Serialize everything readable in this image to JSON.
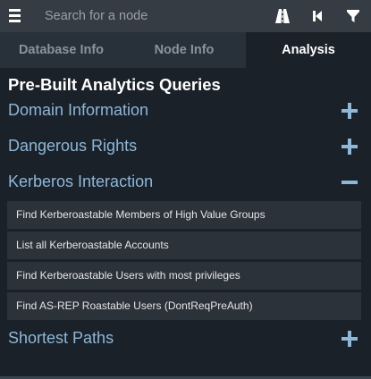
{
  "search": {
    "placeholder": "Search for a node"
  },
  "toolbar": {
    "menu_icon": "hamburger-menu-icon",
    "pathfinding_icon": "road-icon",
    "back_icon": "step-backward-icon",
    "filter_icon": "filter-icon"
  },
  "tabs": [
    {
      "label": "Database Info",
      "active": false
    },
    {
      "label": "Node Info",
      "active": false
    },
    {
      "label": "Analysis",
      "active": true
    }
  ],
  "analysis": {
    "title": "Pre-Built Analytics Queries",
    "groups": [
      {
        "label": "Domain Information",
        "expanded": false
      },
      {
        "label": "Dangerous Rights",
        "expanded": false
      },
      {
        "label": "Kerberos Interaction",
        "expanded": true
      },
      {
        "label": "Shortest Paths",
        "expanded": false
      }
    ],
    "kerberos_queries": [
      "Find Kerberoastable Members of High Value Groups",
      "List all Kerberoastable Accounts",
      "Find Kerberoastable Users with most privileges",
      "Find AS-REP Roastable Users (DontReqPreAuth)"
    ]
  },
  "colors": {
    "accent": "#8cb8d9",
    "background": "#1b2129",
    "searchbar": "#363c44",
    "inactive_tab": "#283039",
    "query_item": "#2c323a"
  }
}
